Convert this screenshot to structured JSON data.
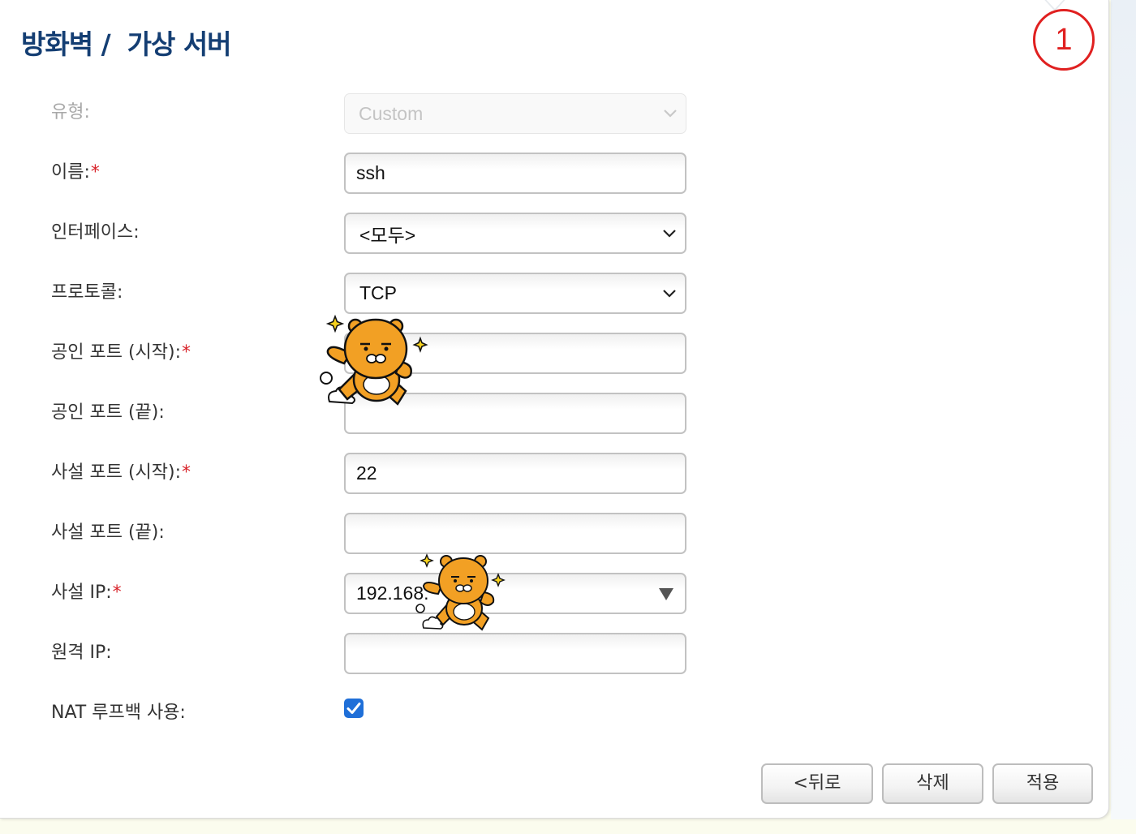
{
  "header": {
    "breadcrumb_parent": "방화벽 /",
    "title": "가상 서버",
    "step_number": "1"
  },
  "form": {
    "type": {
      "label": "유형:",
      "value": "Custom"
    },
    "name": {
      "label": "이름:",
      "value": "ssh"
    },
    "interface": {
      "label": "인터페이스:",
      "value": "<모두>"
    },
    "protocol": {
      "label": "프로토콜:",
      "value": "TCP"
    },
    "public_port_start": {
      "label": "공인 포트 (시작):",
      "value": ""
    },
    "public_port_end": {
      "label": "공인 포트 (끝):",
      "value": ""
    },
    "private_port_start": {
      "label": "사설 포트 (시작):",
      "value": "22"
    },
    "private_port_end": {
      "label": "사설 포트 (끝):",
      "value": ""
    },
    "private_ip": {
      "label": "사설 IP:",
      "value": "192.168."
    },
    "remote_ip": {
      "label": "원격 IP:",
      "value": ""
    },
    "nat_loopback": {
      "label": "NAT 루프백 사용:",
      "checked": true
    },
    "required_mark": "*"
  },
  "buttons": {
    "back": "<뒤로",
    "delete": "삭제",
    "apply": "적용"
  },
  "colors": {
    "title": "#143e73",
    "required": "#d8232a",
    "step_circle": "#e02020",
    "checkbox": "#1f6fd8",
    "mascot": "#f2a024"
  }
}
